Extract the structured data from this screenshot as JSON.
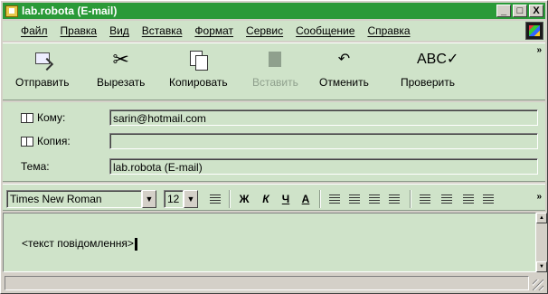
{
  "window": {
    "title": "lab.robota (E-mail)",
    "controls": {
      "minimize": "_",
      "maximize": "□",
      "close": "X"
    }
  },
  "menu": {
    "items": [
      "Файл",
      "Правка",
      "Вид",
      "Вставка",
      "Формат",
      "Сервис",
      "Сообщение",
      "Справка"
    ]
  },
  "toolbar": {
    "send": "Отправить",
    "cut": "Вырезать",
    "copy": "Копировать",
    "paste": "Вставить",
    "undo": "Отменить",
    "check": "Проверить",
    "more": "»"
  },
  "header": {
    "to_label": "Кому:",
    "to_value": "sarin@hotmail.com",
    "cc_label": "Копия:",
    "cc_value": "",
    "subject_label": "Тема:",
    "subject_value": "lab.robota (E-mail)"
  },
  "format": {
    "font": "Times New Roman",
    "size": "12",
    "bold": "Ж",
    "italic": "К",
    "underline": "Ч",
    "font_color": "A",
    "more": "»"
  },
  "body": {
    "text": "<текст повідомлення>"
  },
  "colors": {
    "titlebar": "#2a9a38",
    "panel": "#cfe3c9"
  }
}
